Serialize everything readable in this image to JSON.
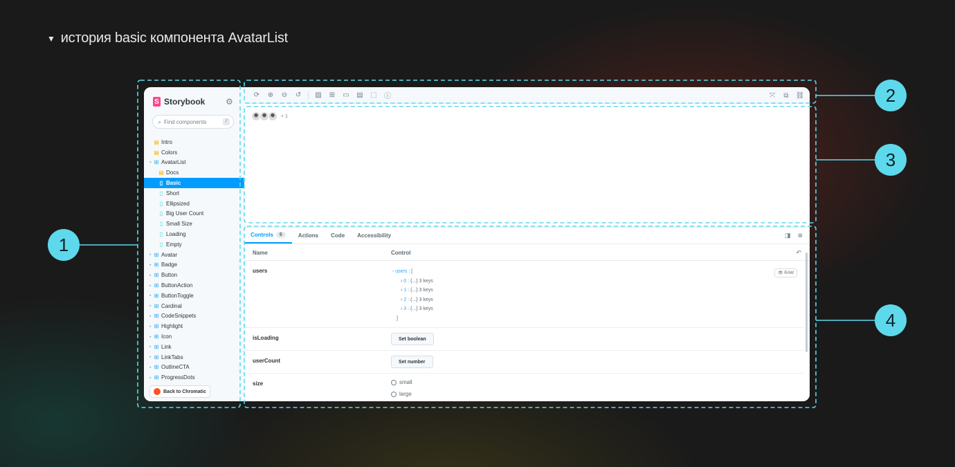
{
  "heading": {
    "triangle": "▼",
    "text": "история basic компонента AvatarList"
  },
  "sidebar": {
    "brand": "Storybook",
    "search_placeholder": "Find components",
    "search_shortcut": "/",
    "items": [
      {
        "label": "Intro",
        "icon": "doc",
        "level": 0,
        "expandable": false
      },
      {
        "label": "Colors",
        "icon": "doc",
        "level": 0,
        "expandable": false
      },
      {
        "label": "AvatarList",
        "icon": "comp",
        "level": 0,
        "expandable": true
      },
      {
        "label": "Docs",
        "icon": "doc",
        "level": 1,
        "expandable": false
      },
      {
        "label": "Basic",
        "icon": "story",
        "level": 1,
        "expandable": false,
        "active": true
      },
      {
        "label": "Short",
        "icon": "story",
        "level": 1,
        "expandable": false
      },
      {
        "label": "Ellipsized",
        "icon": "story",
        "level": 1,
        "expandable": false
      },
      {
        "label": "Big User Count",
        "icon": "story",
        "level": 1,
        "expandable": false
      },
      {
        "label": "Small Size",
        "icon": "story",
        "level": 1,
        "expandable": false
      },
      {
        "label": "Loading",
        "icon": "story",
        "level": 1,
        "expandable": false
      },
      {
        "label": "Empty",
        "icon": "story",
        "level": 1,
        "expandable": false
      },
      {
        "label": "Avatar",
        "icon": "comp",
        "level": 0,
        "expandable": true
      },
      {
        "label": "Badge",
        "icon": "comp",
        "level": 0,
        "expandable": true
      },
      {
        "label": "Button",
        "icon": "comp",
        "level": 0,
        "expandable": true
      },
      {
        "label": "ButtonAction",
        "icon": "comp",
        "level": 0,
        "expandable": true
      },
      {
        "label": "ButtonToggle",
        "icon": "comp",
        "level": 0,
        "expandable": true
      },
      {
        "label": "Cardinal",
        "icon": "comp",
        "level": 0,
        "expandable": true
      },
      {
        "label": "CodeSnippets",
        "icon": "comp",
        "level": 0,
        "expandable": true
      },
      {
        "label": "Highlight",
        "icon": "comp",
        "level": 0,
        "expandable": true
      },
      {
        "label": "Icon",
        "icon": "comp",
        "level": 0,
        "expandable": true
      },
      {
        "label": "Link",
        "icon": "comp",
        "level": 0,
        "expandable": true
      },
      {
        "label": "LinkTabs",
        "icon": "comp",
        "level": 0,
        "expandable": true
      },
      {
        "label": "OutlineCTA",
        "icon": "comp",
        "level": 0,
        "expandable": true
      },
      {
        "label": "ProgressDots",
        "icon": "comp",
        "level": 0,
        "expandable": true
      }
    ],
    "back_button": "Back to Chromatic"
  },
  "canvas": {
    "plus_count": "+ 1"
  },
  "addons": {
    "tabs": [
      {
        "label": "Controls",
        "badge": "6",
        "active": true
      },
      {
        "label": "Actions"
      },
      {
        "label": "Code"
      },
      {
        "label": "Accessibility"
      }
    ],
    "header": {
      "name": "Name",
      "control": "Control"
    },
    "rows": {
      "users": {
        "name": "users",
        "json_key": "users",
        "json_open": "[",
        "entries": [
          {
            "idx": "0",
            "val": "{...} 3 keys"
          },
          {
            "idx": "1",
            "val": "{...} 3 keys"
          },
          {
            "idx": "2",
            "val": "{...} 3 keys"
          },
          {
            "idx": "3",
            "val": "{...} 3 keys"
          }
        ],
        "json_close": "]",
        "raw": "RAW"
      },
      "isLoading": {
        "name": "isLoading",
        "button": "Set boolean"
      },
      "userCount": {
        "name": "userCount",
        "button": "Set number"
      },
      "size": {
        "name": "size",
        "options": [
          "small",
          "large"
        ]
      }
    }
  },
  "annotations": [
    "1",
    "2",
    "3",
    "4"
  ],
  "colors": {
    "accent": "#029cfd",
    "annotation": "#5ed9ec",
    "brand": "#ff4785"
  }
}
